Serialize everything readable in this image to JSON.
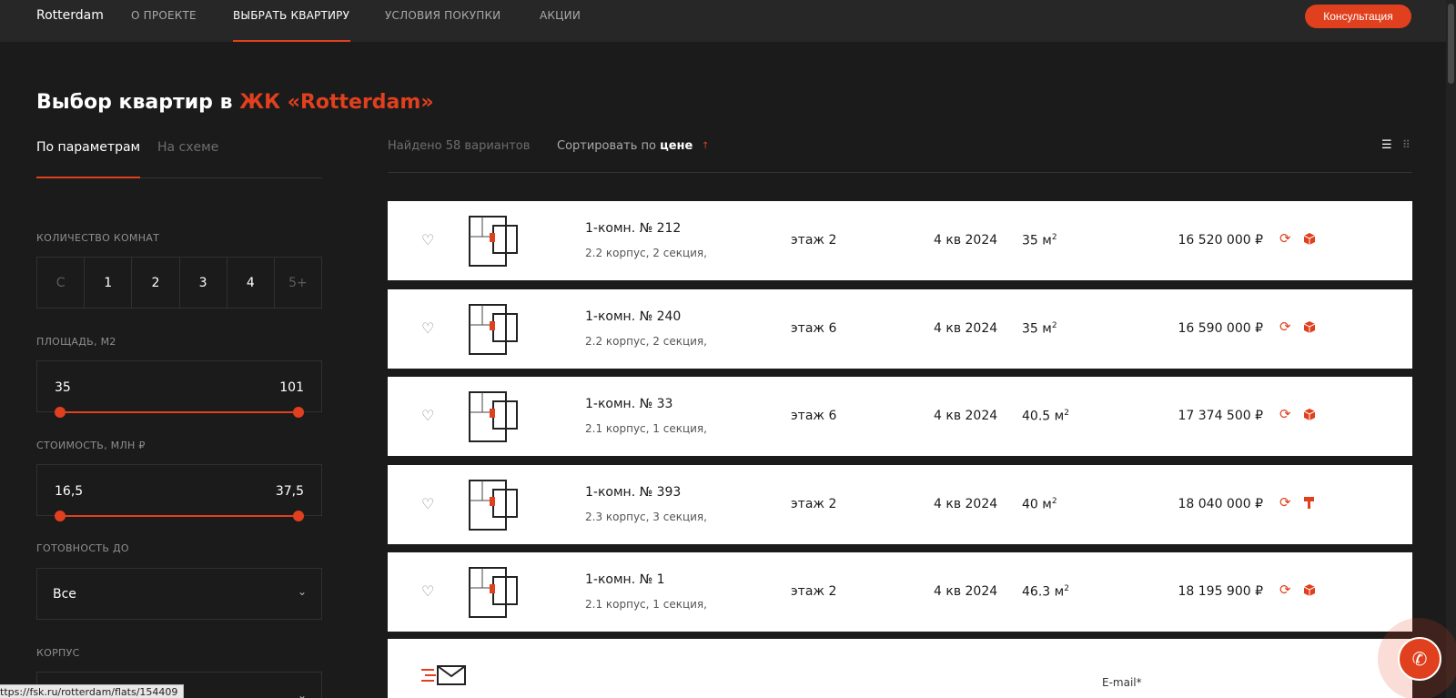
{
  "nav": {
    "brand": "Rotterdam",
    "items": [
      "О ПРОЕКТЕ",
      "ВЫБРАТЬ КВАРТИРУ",
      "УСЛОВИЯ ПОКУПКИ",
      "АКЦИИ"
    ],
    "active_item": "ВЫБРАТЬ КВАРТИРУ",
    "consult_label": "Консультация"
  },
  "page": {
    "title_prefix": "Выбор квартир в ",
    "title_accent": "ЖК «Rotterdam»"
  },
  "tabs": {
    "active": "По параметрам",
    "inactive": "На схеме"
  },
  "filters": {
    "rooms_label": "КОЛИЧЕСТВО КОМНАТ",
    "rooms": [
      "С",
      "1",
      "2",
      "3",
      "4",
      "5+"
    ],
    "area_label": "ПЛОЩАДЬ, М2",
    "area_min": "35",
    "area_max": "101",
    "price_label": "СТОИМОСТЬ, МЛН ₽",
    "price_min": "16,5",
    "price_max": "37,5",
    "ready_label": "ГОТОВНОСТЬ ДО",
    "ready_value": "Все",
    "building_label": "КОРПУС"
  },
  "results": {
    "found": "Найдено 58 вариантов",
    "sort_prefix": "Сортировать по ",
    "sort_key": "цене",
    "sort_arrow": "↑"
  },
  "flats": [
    {
      "name": "1-комн. № 212",
      "address": "2.2 корпус, 2 секция,",
      "floor": "этаж 2",
      "deadline": "4 кв 2024",
      "area": "35 м",
      "price": "16 520 000 ₽",
      "finish_icon": "box-icon"
    },
    {
      "name": "1-комн. № 240",
      "address": "2.2 корпус, 2 секция,",
      "floor": "этаж 6",
      "deadline": "4 кв 2024",
      "area": "35 м",
      "price": "16 590 000 ₽",
      "finish_icon": "box-icon"
    },
    {
      "name": "1-комн. № 33",
      "address": "2.1 корпус, 1 секция,",
      "floor": "этаж 6",
      "deadline": "4 кв 2024",
      "area": "40.5 м",
      "price": "17 374 500 ₽",
      "finish_icon": "box-icon"
    },
    {
      "name": "1-комн. № 393",
      "address": "2.3 корпус, 3 секция,",
      "floor": "этаж 2",
      "deadline": "4 кв 2024",
      "area": "40 м",
      "price": "18 040 000 ₽",
      "finish_icon": "paint-roller-icon"
    },
    {
      "name": "1-комн. № 1",
      "address": "2.1 корпус, 1 секция,",
      "floor": "этаж 2",
      "deadline": "4 кв 2024",
      "area": "46.3 м",
      "price": "18 195 900 ₽",
      "finish_icon": "box-icon"
    }
  ],
  "area_unit_power": "2",
  "subscribe": {
    "email_label": "E-mail*"
  },
  "status_url": "ttps://fsk.ru/rotterdam/flats/154409",
  "colors": {
    "accent": "#e0401d",
    "background": "#1b1b1c",
    "nav": "#272728",
    "card": "#ffffff"
  }
}
